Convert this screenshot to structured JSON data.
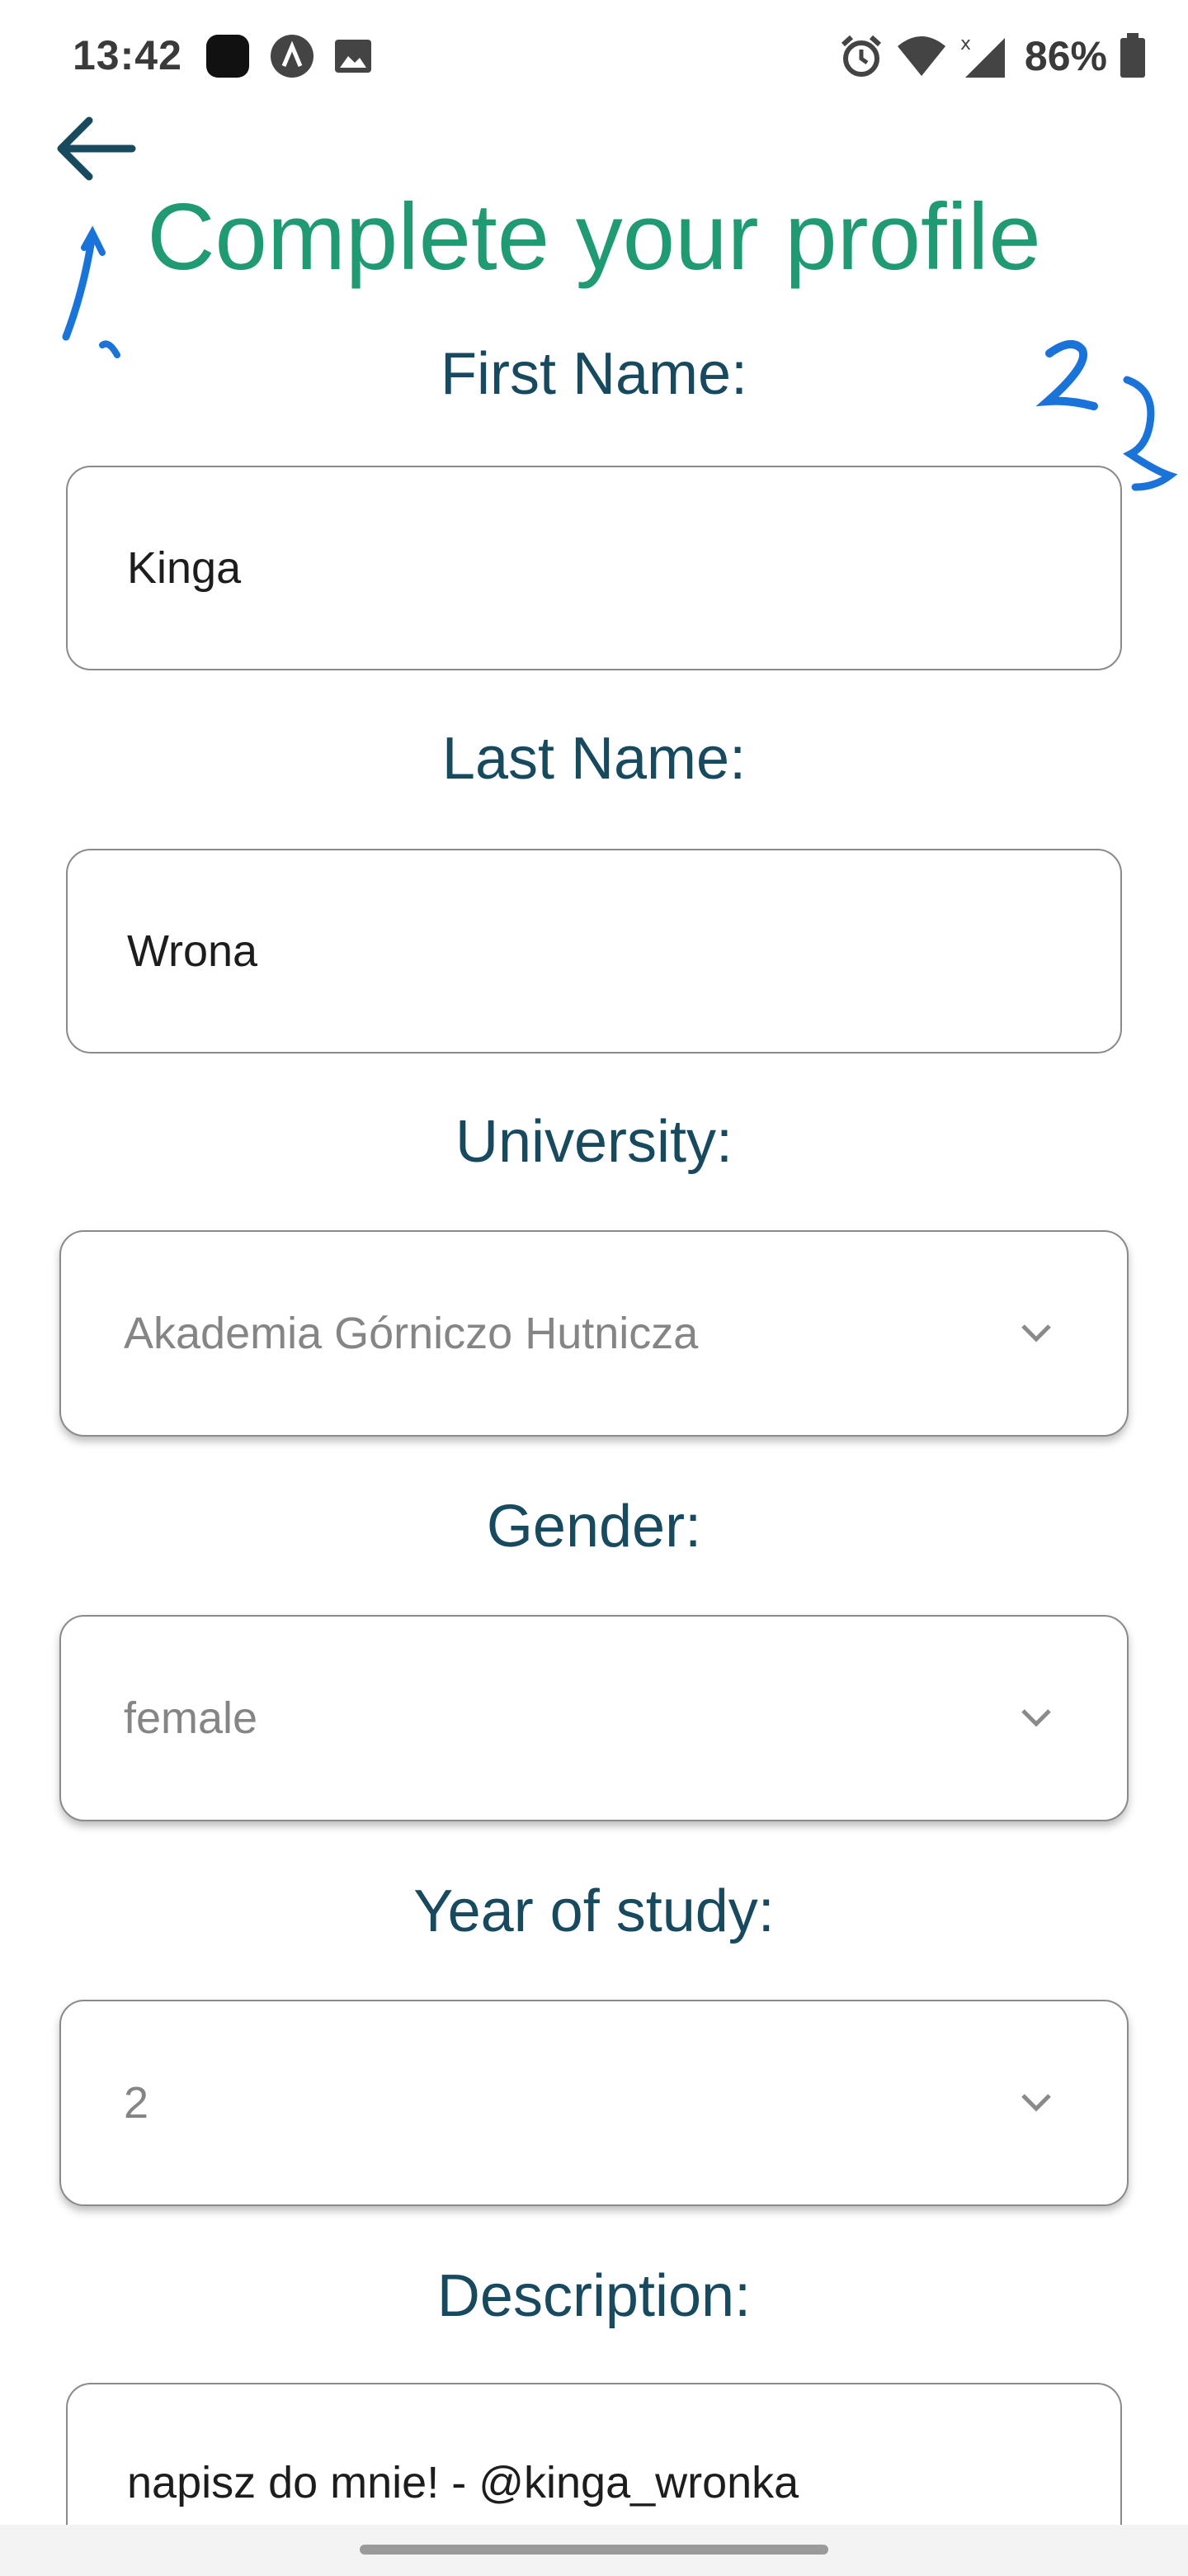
{
  "status_bar": {
    "time": "13:42",
    "battery": "86%",
    "left_icons": [
      "app-icon",
      "a-icon",
      "image-icon"
    ],
    "right_icons": [
      "alarm-icon",
      "wifi-icon",
      "signal-icon",
      "battery-icon"
    ]
  },
  "header": {
    "back_icon": "arrow-left-icon",
    "title": "Complete your profile"
  },
  "annotations": [
    "1.",
    "2"
  ],
  "form": {
    "first_name": {
      "label": "First Name:",
      "value": "Kinga"
    },
    "last_name": {
      "label": "Last Name:",
      "value": "Wrona"
    },
    "university": {
      "label": "University:",
      "value": "Akademia Górniczo Hutnicza"
    },
    "gender": {
      "label": "Gender:",
      "value": "female"
    },
    "year_of_study": {
      "label": "Year of study:",
      "value": "2"
    },
    "description": {
      "label": "Description:",
      "value": "napisz do mnie! - @kinga_wronka"
    }
  },
  "colors": {
    "title": "#1f9a73",
    "label": "#174a5f",
    "annotation": "#1a73d8"
  }
}
